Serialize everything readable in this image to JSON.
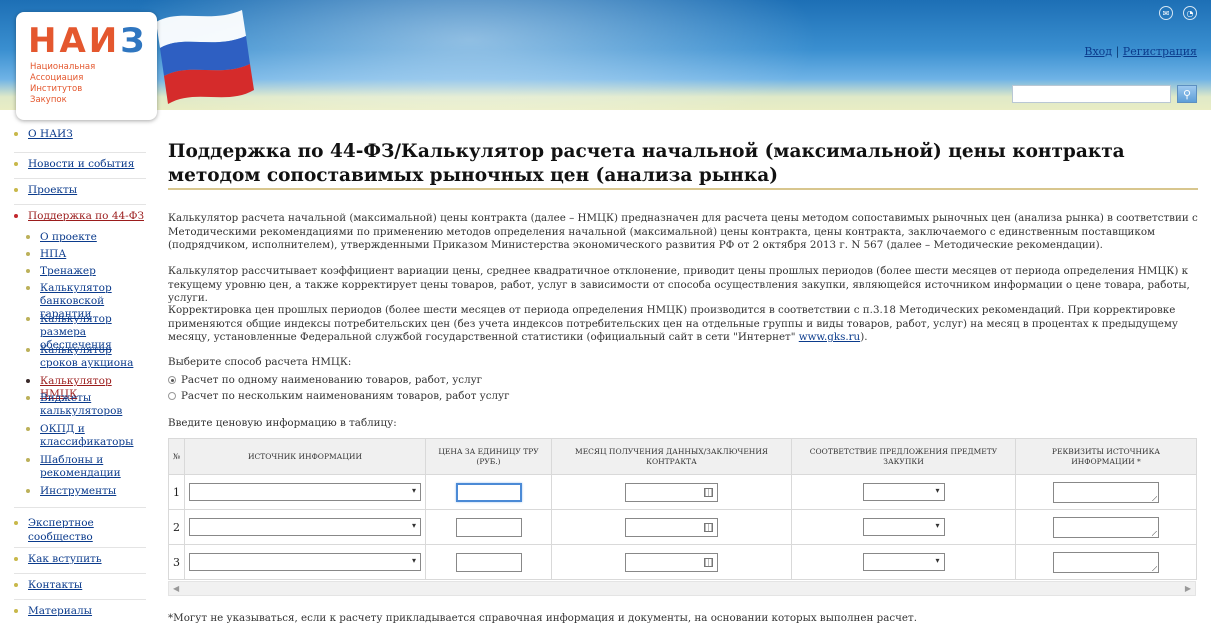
{
  "logo": {
    "mark_a": "НАИ",
    "mark_b": "З",
    "lines": [
      "Национальная",
      "Ассоциация",
      "Институтов",
      "Закупок"
    ]
  },
  "header": {
    "login": "Вход",
    "separator": "|",
    "register": "Регистрация",
    "search_placeholder": "",
    "icons": [
      "mail-icon",
      "rss-icon"
    ]
  },
  "sidebar": {
    "items": [
      {
        "label": "О НАИЗ"
      },
      {
        "label": "Новости и события"
      },
      {
        "label": "Проекты"
      },
      {
        "label": "Поддержка по 44-ФЗ"
      }
    ],
    "sub": [
      {
        "label": "О проекте"
      },
      {
        "label": "НПА"
      },
      {
        "label": "Тренажер"
      },
      {
        "label": "Калькулятор банковской гарантии"
      },
      {
        "label": "Калькулятор размера обеспечения"
      },
      {
        "label": "Калькулятор сроков аукциона"
      },
      {
        "label": "Калькулятор НМЦК"
      },
      {
        "label": "Виджеты калькуляторов"
      },
      {
        "label": "ОКПД и классификаторы"
      },
      {
        "label": "Шаблоны и рекомендации"
      },
      {
        "label": "Инструменты"
      }
    ],
    "bottom": [
      {
        "label": "Экспертное сообщество"
      },
      {
        "label": "Как вступить"
      },
      {
        "label": "Контакты"
      },
      {
        "label": "Материалы"
      }
    ]
  },
  "main": {
    "title": "Поддержка по 44-ФЗ/Калькулятор расчета начальной (максимальной) цены контракта методом сопоставимых рыночных цен (анализа рынка)",
    "p1": "Калькулятор расчета начальной (максимальной) цены контракта (далее – НМЦК) предназначен для расчета цены методом сопоставимых рыночных цен (анализа рынка) в соответствии с Методическими рекомендациями по применению методов определения начальной (максимальной) цены контракта, цены контракта, заключаемого с единственным поставщиком (подрядчиком, исполнителем), утвержденными Приказом Министерства экономического развития РФ от 2 октября 2013 г. N 567 (далее – Методические рекомендации).",
    "p2": "Калькулятор рассчитывает коэффициент вариации цены, среднее квадратичное отклонение, приводит цены прошлых периодов (более шести месяцев от периода определения НМЦК) к текущему уровню цен, а также корректирует цены товаров, работ, услуг в зависимости от способа осуществления закупки, являющейся источником информации о цене товара, работы, услуги.",
    "p3_text": "Корректировка цен прошлых периодов (более шести месяцев от периода определения НМЦК) производится в соответствии с п.3.18 Методических рекомендаций. При корректировке применяются общие индексы потребительских цен (без учета индексов потребительских цен на отдельные группы и виды товаров, работ, услуг) на месяц в процентах к предыдущему месяцу, установленные Федеральной службой государственной статистики (официальный сайт в сети \"Интернет\" ",
    "p3_link": "www.gks.ru",
    "p3_end": ").",
    "choose_label": "Выберите способ расчета НМЦК:",
    "radio_single": "Расчет по одному наименованию товаров, работ, услуг",
    "radio_multi": "Расчет по нескольким наименованиям товаров, работ услуг",
    "enter_label": "Введите ценовую информацию в таблицу:",
    "footnote": "*Могут не указываться, если к расчету прикладывается справочная информация и документы, на основании которых выполнен расчет."
  },
  "table": {
    "headers": [
      "№",
      "Источник информации",
      "Цена за единицу ТРУ (руб.)",
      "Месяц получения данных/заключения контракта",
      "Соответствие предложения предмету закупки",
      "Реквизиты источника информации *"
    ],
    "rows": [
      "1",
      "2",
      "3"
    ]
  }
}
